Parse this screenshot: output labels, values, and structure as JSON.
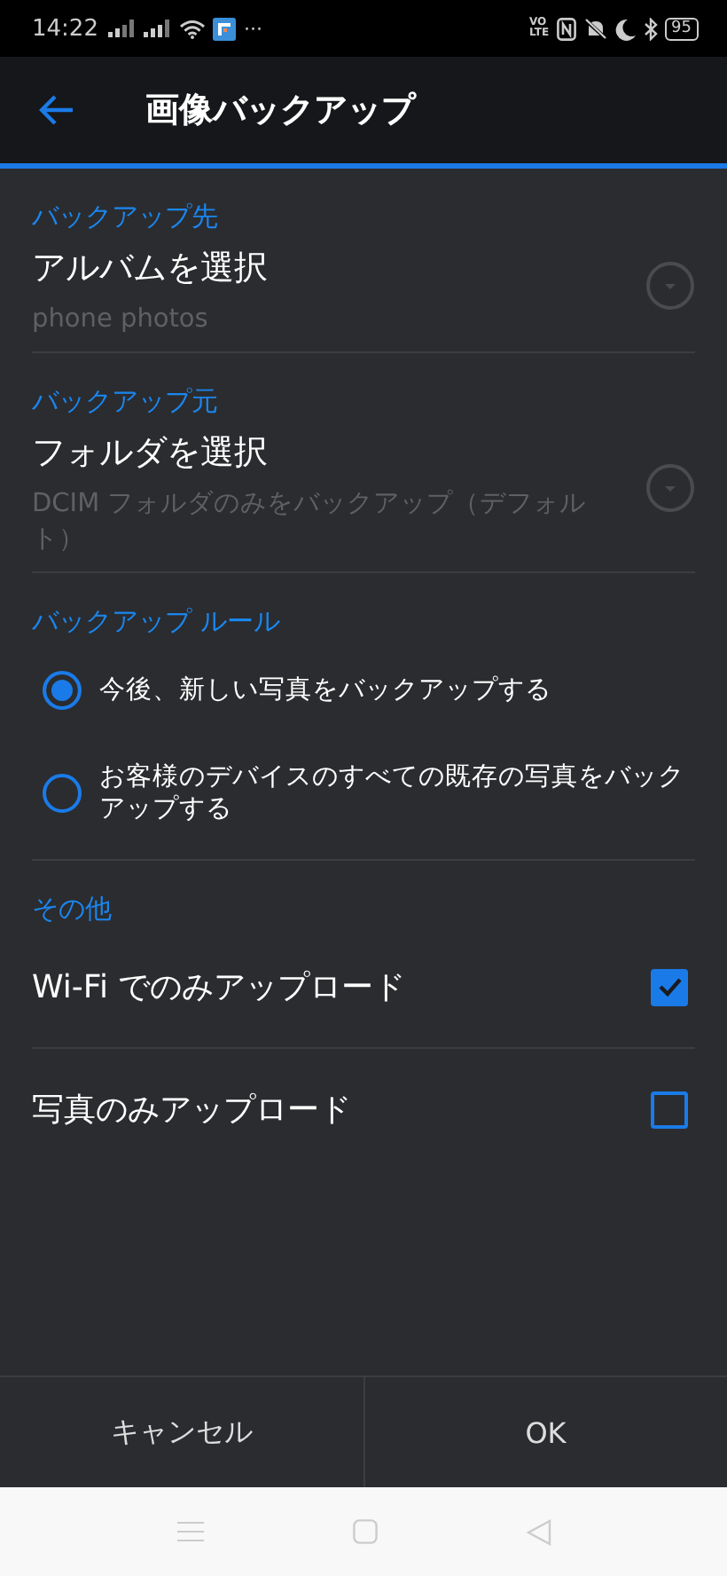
{
  "status_bar": {
    "time": "14:22",
    "more": "···",
    "volte": [
      "VO",
      "LTE"
    ],
    "battery": "95"
  },
  "header": {
    "title": "画像バックアップ"
  },
  "sections": [
    {
      "title": "バックアップ先",
      "kind": "picker",
      "label": "アルバムを選択",
      "value": "phone photos"
    },
    {
      "title": "バックアップ元",
      "kind": "picker",
      "label": "フォルダを選択",
      "value": "DCIM フォルダのみをバックアップ（デフォルト）"
    },
    {
      "title": "バックアップ ルール",
      "kind": "radios",
      "options": [
        {
          "label": "今後、新しい写真をバックアップする",
          "selected": true
        },
        {
          "label": "お客様のデバイスのすべての既存の写真をバックアップする",
          "selected": false
        }
      ]
    },
    {
      "title": "その他",
      "kind": "checks",
      "options": [
        {
          "label": "Wi-Fi でのみアップロード",
          "checked": true
        },
        {
          "label": "写真のみアップロード",
          "checked": false
        }
      ]
    }
  ],
  "buttons": [
    "キャンセル",
    "OK"
  ]
}
